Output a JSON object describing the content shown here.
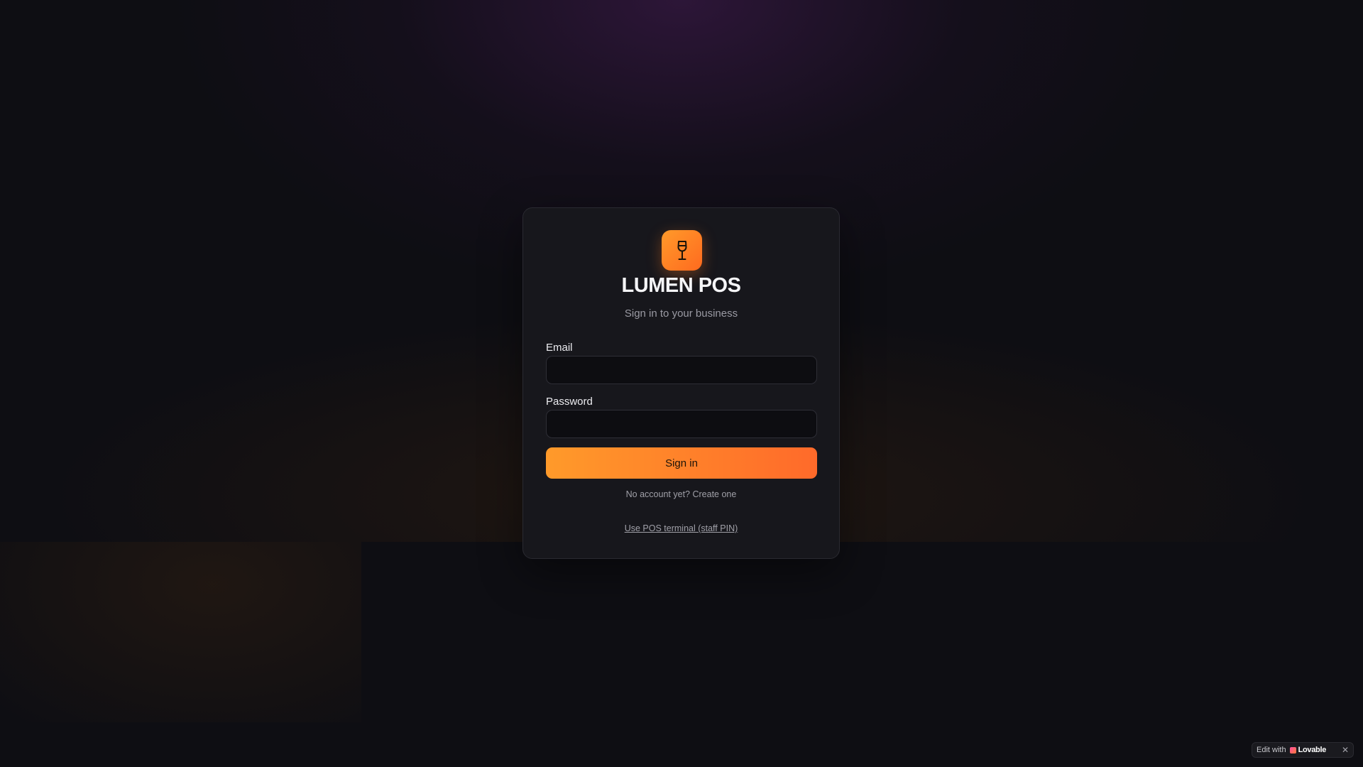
{
  "brand": {
    "name": "LUMEN POS",
    "subtitle": "Sign in to your business",
    "logo_icon": "wine-glass-icon",
    "accent_start": "#ff9a2a",
    "accent_end": "#ff6a1f"
  },
  "form": {
    "email_label": "Email",
    "email_value": "",
    "email_placeholder": "",
    "password_label": "Password",
    "password_value": "",
    "password_placeholder": "",
    "submit_label": "Sign in",
    "signup_prompt": "No account yet?",
    "signup_link": "Create one",
    "pos_terminal_link": "Use POS terminal (staff PIN)"
  },
  "badge": {
    "edit_text": "Edit with",
    "brand_name": "Lovable",
    "close_icon": "close-icon"
  },
  "colors": {
    "background": "#0e0e13",
    "card": "#17171c"
  }
}
